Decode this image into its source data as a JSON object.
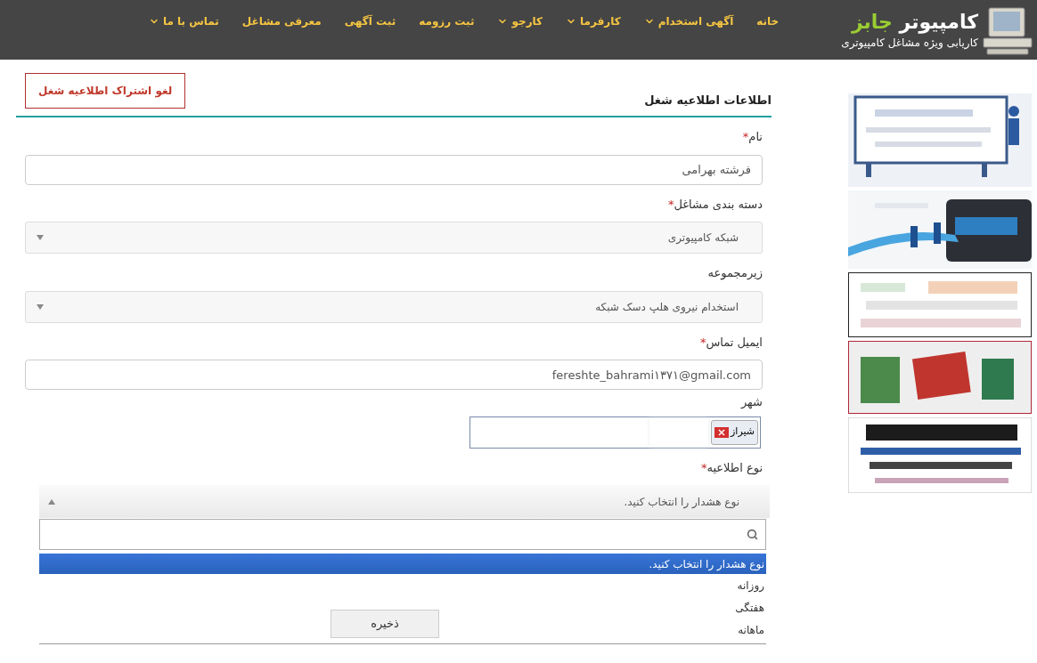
{
  "header": {
    "logo": {
      "title_main": "کامپیوتر",
      "title_accent": "جابز",
      "tagline": "کاریابی ویژه مشاغل کامپیوتری"
    },
    "nav": [
      {
        "label": "خانه",
        "has_menu": false
      },
      {
        "label": "آگهی استخدام",
        "has_menu": true
      },
      {
        "label": "کارفرما",
        "has_menu": true
      },
      {
        "label": "کارجو",
        "has_menu": true
      },
      {
        "label": "ثبت رزومه",
        "has_menu": false
      },
      {
        "label": "ثبت آگهی",
        "has_menu": false
      },
      {
        "label": "معرفی مشاغل",
        "has_menu": false
      },
      {
        "label": "تماس با ما",
        "has_menu": true
      }
    ]
  },
  "form": {
    "title": "اطلاعات اطلاعیه شغل",
    "unsubscribe_button": "لغو اشتراک اطلاعیه شغل",
    "fields": [
      {
        "kind": "text",
        "label": "نام",
        "required_mark": "*",
        "value": "فرشته بهرامی"
      },
      {
        "kind": "select",
        "label": "دسته بندی مشاغل",
        "required_mark": "*",
        "value": "شبکه کامپیوتری"
      },
      {
        "kind": "select",
        "label": "زیرمجموعه",
        "value": "استخدام نیروی هلپ دسک شبکه"
      },
      {
        "kind": "email",
        "label": "ایمیل تماس",
        "required_mark": "*",
        "value": "fereshte_bahrami۱۳۷۱@gmail.com"
      },
      {
        "kind": "tags",
        "label": "شهر",
        "tags": [
          "شیراز"
        ]
      },
      {
        "kind": "open_select",
        "label": "نوع اطلاعیه",
        "required_mark": "*",
        "value": "نوع هشدار را انتخاب کنید.",
        "options": [
          {
            "label": "نوع هشدار را انتخاب کنید.",
            "selected": true
          },
          {
            "label": "روزانه",
            "selected": false
          },
          {
            "label": "هفتگی",
            "selected": false
          },
          {
            "label": "ماهانه",
            "selected": false
          }
        ]
      }
    ],
    "save_button": "ذخیره"
  }
}
